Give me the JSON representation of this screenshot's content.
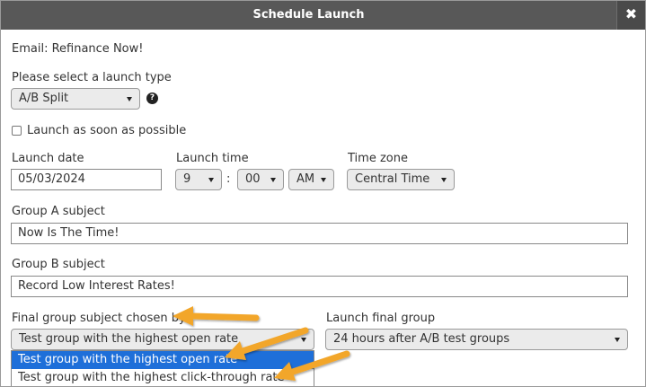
{
  "dialog": {
    "title": "Schedule Launch",
    "close_glyph": "✖"
  },
  "email_line": "Email: Refinance Now!",
  "launch_type": {
    "label": "Please select a launch type",
    "value": "A/B Split",
    "help_glyph": "?"
  },
  "asap": {
    "label": "Launch as soon as possible",
    "checked": false
  },
  "launch_date": {
    "label": "Launch date",
    "value": "05/03/2024"
  },
  "launch_time": {
    "label": "Launch time",
    "hour": "9",
    "separator": ":",
    "minute": "00",
    "ampm": "AM"
  },
  "time_zone": {
    "label": "Time zone",
    "value": "Central Time"
  },
  "group_a": {
    "label": "Group A subject",
    "value": "Now Is The Time!"
  },
  "group_b": {
    "label": "Group B subject",
    "value": "Record Low Interest Rates!"
  },
  "final_subject": {
    "label": "Final group subject chosen by",
    "value": "Test group with the highest open rate",
    "options": [
      "Test group with the highest open rate",
      "Test group with the highest click-through rate"
    ],
    "selected_index": 0
  },
  "launch_final": {
    "label": "Launch final group",
    "value": "24 hours after A/B test groups"
  },
  "colors": {
    "titlebar": "#585858",
    "selected_option": "#1e6fd9",
    "annotation_arrow": "#f2a62a"
  },
  "icons": {
    "close": "close-icon",
    "help": "help-icon",
    "dropdown": "chevron-down-icon"
  }
}
